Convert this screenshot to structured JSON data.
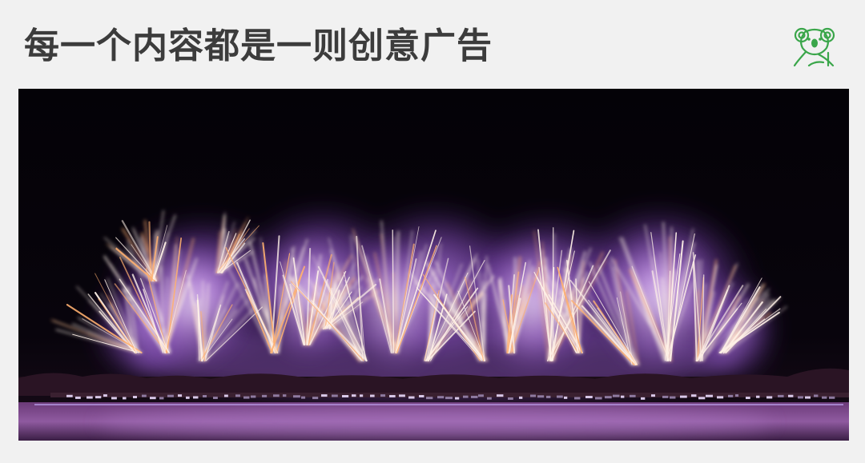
{
  "page": {
    "title": "每一个内容都是一则创意广告"
  },
  "logo": {
    "icon": "koala-icon",
    "color": "#3aa64a"
  },
  "photo": {
    "subject": "fireworks-display",
    "colors": {
      "sky": "#050308",
      "smoke": "#9a5fd0",
      "spark": "#fff2e8",
      "spark_warm": "#ffb070",
      "water": "#8a4a9a"
    }
  }
}
